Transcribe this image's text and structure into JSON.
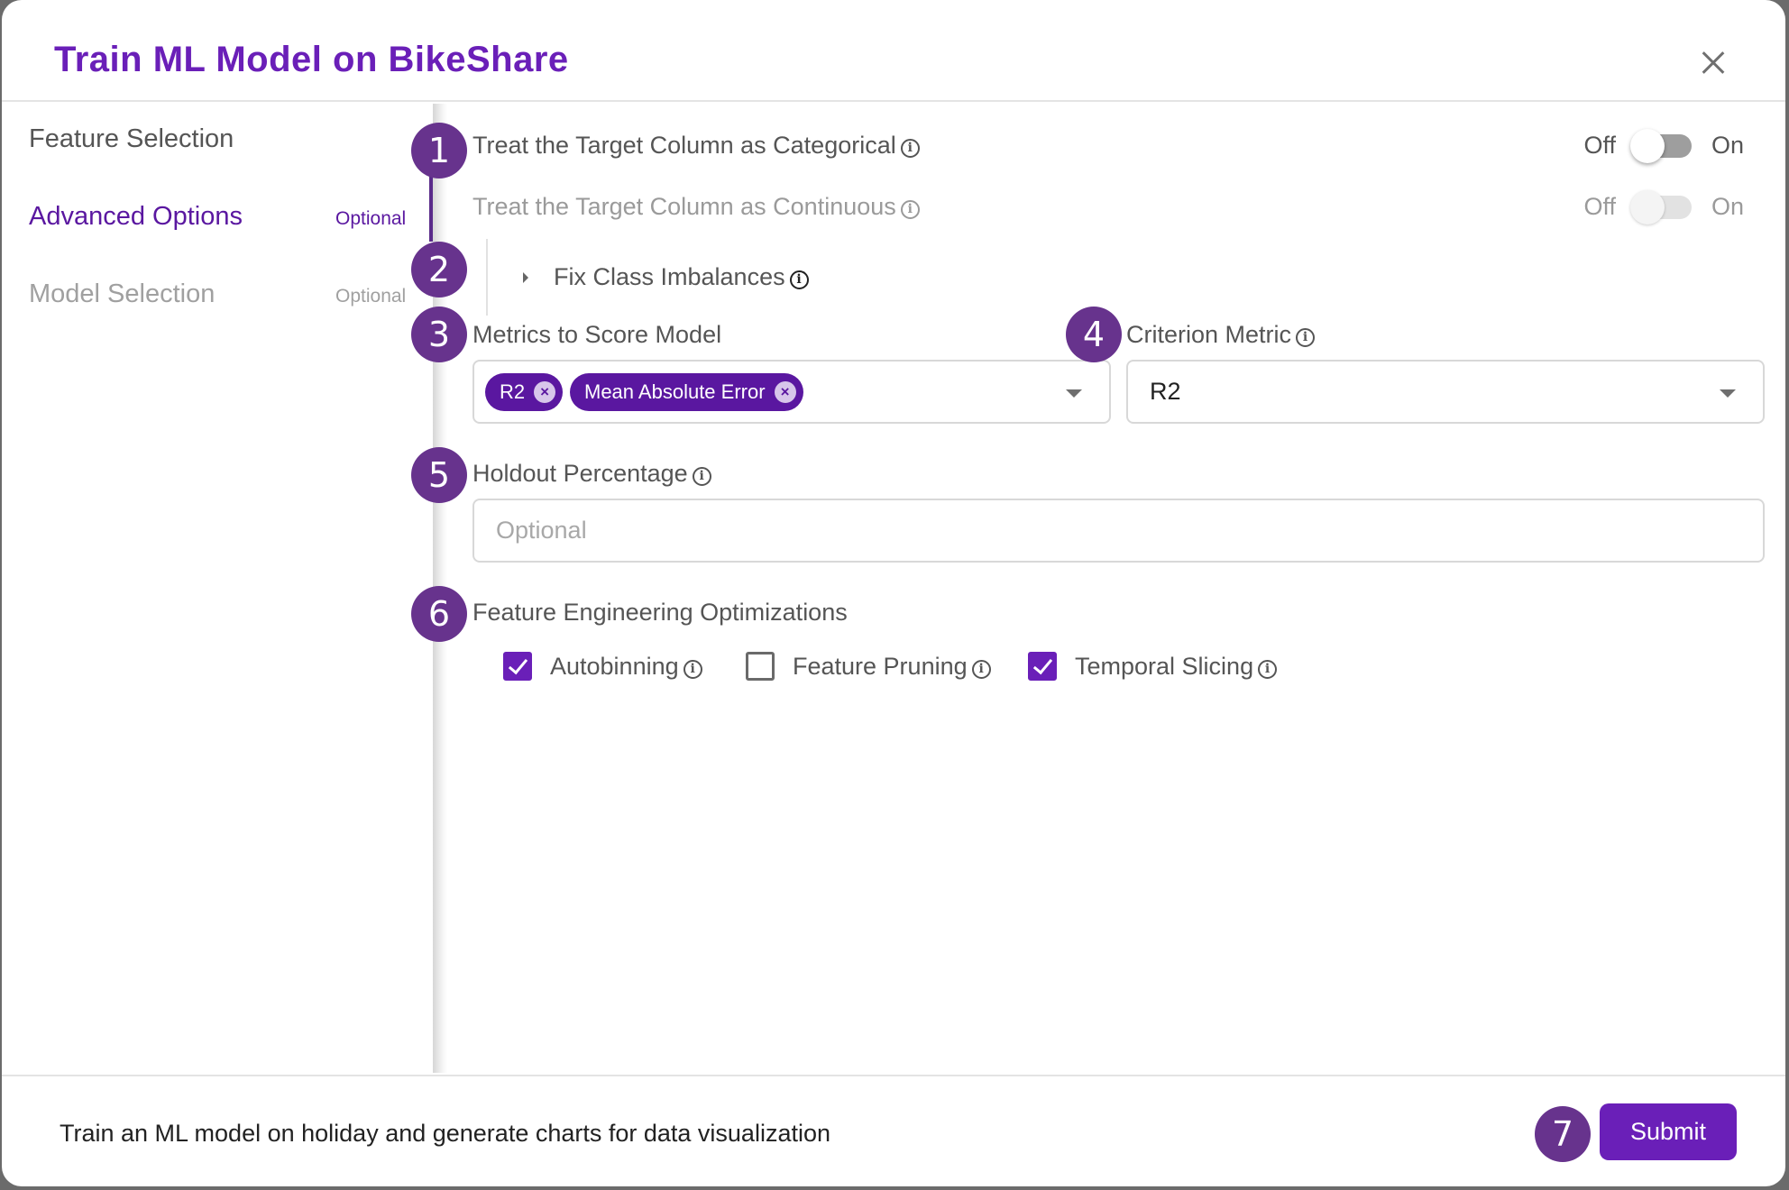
{
  "dialog": {
    "title": "Train ML Model on BikeShare",
    "close_icon": "close-icon"
  },
  "sidebar": {
    "items": [
      {
        "label": "Feature Selection",
        "tag": "",
        "state": "completed"
      },
      {
        "label": "Advanced Options",
        "tag": "Optional",
        "state": "active"
      },
      {
        "label": "Model Selection",
        "tag": "Optional",
        "state": "inactive"
      }
    ]
  },
  "colors": {
    "accent": "#6a1fb8",
    "chip": "#5a17a0",
    "step_badge": "#67338d"
  },
  "steps": [
    "1",
    "2",
    "3",
    "4",
    "5",
    "6",
    "7"
  ],
  "advanced": {
    "categorical": {
      "label": "Treat the Target Column as Categorical",
      "off_label": "Off",
      "on_label": "On",
      "value": false,
      "disabled": false
    },
    "continuous": {
      "label": "Treat the Target Column as Continuous",
      "off_label": "Off",
      "on_label": "On",
      "value": false,
      "disabled": true
    },
    "fix_class": {
      "label": "Fix Class Imbalances",
      "expanded": false
    },
    "metrics": {
      "label": "Metrics to Score Model",
      "selected": [
        "R2",
        "Mean Absolute Error"
      ]
    },
    "criterion": {
      "label": "Criterion Metric",
      "value": "R2"
    },
    "holdout": {
      "label": "Holdout Percentage",
      "value": "",
      "placeholder": "Optional"
    },
    "feature_engineering": {
      "label": "Feature Engineering Optimizations",
      "options": [
        {
          "label": "Autobinning",
          "checked": true
        },
        {
          "label": "Feature Pruning",
          "checked": false
        },
        {
          "label": "Temporal Slicing",
          "checked": true
        }
      ]
    }
  },
  "footer": {
    "description": "Train an ML model on holiday and generate charts for data visualization",
    "submit_label": "Submit"
  },
  "info_glyph": "i",
  "remove_glyph": "×"
}
